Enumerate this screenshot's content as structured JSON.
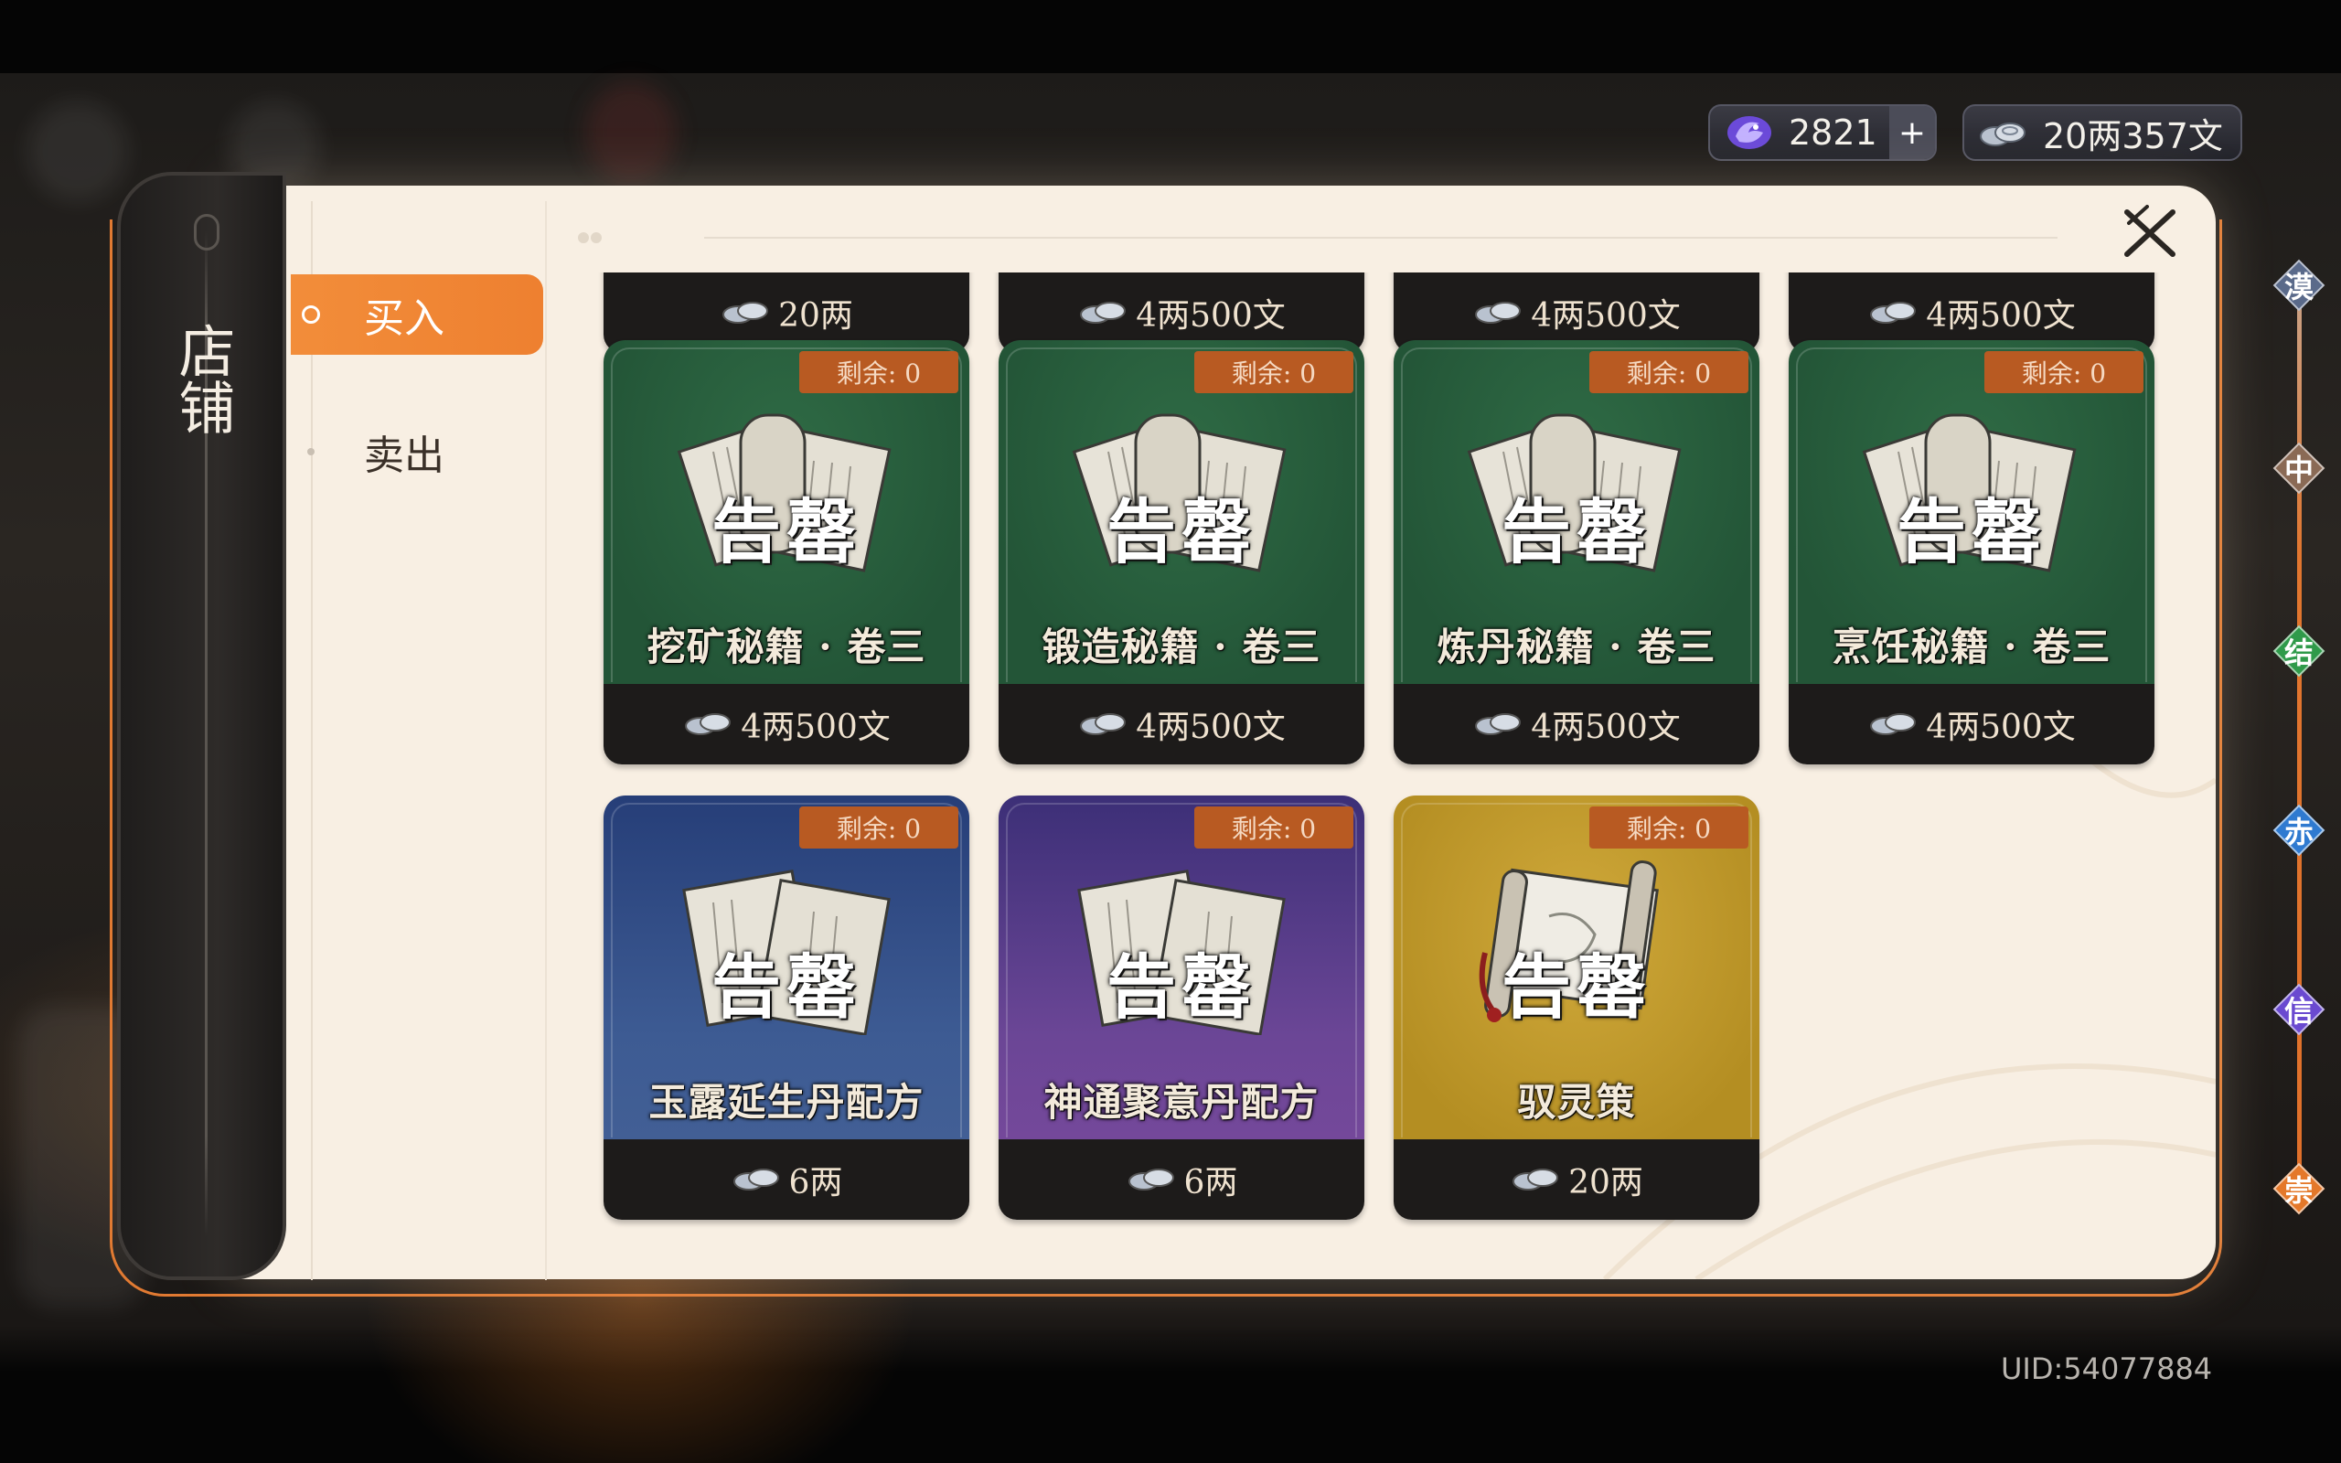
{
  "currency": {
    "spirit_stone": "2821",
    "plus": "+",
    "money": "20两357文"
  },
  "shop": {
    "title": "店铺",
    "tabs": {
      "buy": "买入",
      "sell": "卖出"
    }
  },
  "top_row_prices": [
    "20两",
    "4两500文",
    "4两500文",
    "4两500文"
  ],
  "items": [
    {
      "name": "挖矿秘籍 · 卷三",
      "remain": "剩余: 0",
      "stamp": "告罄",
      "price": "4两500文",
      "color": "green"
    },
    {
      "name": "锻造秘籍 · 卷三",
      "remain": "剩余: 0",
      "stamp": "告罄",
      "price": "4两500文",
      "color": "green"
    },
    {
      "name": "炼丹秘籍 · 卷三",
      "remain": "剩余: 0",
      "stamp": "告罄",
      "price": "4两500文",
      "color": "green"
    },
    {
      "name": "烹饪秘籍 · 卷三",
      "remain": "剩余: 0",
      "stamp": "告罄",
      "price": "4两500文",
      "color": "green"
    },
    {
      "name": "玉露延生丹配方",
      "remain": "剩余: 0",
      "stamp": "告罄",
      "price": "6两",
      "color": "blue"
    },
    {
      "name": "神通聚意丹配方",
      "remain": "剩余: 0",
      "stamp": "告罄",
      "price": "6两",
      "color": "purple"
    },
    {
      "name": "驭灵策",
      "remain": "剩余: 0",
      "stamp": "告罄",
      "price": "20两",
      "color": "gold"
    }
  ],
  "right_nav": [
    {
      "label": "漠",
      "color": "#5a6a8a"
    },
    {
      "label": "中",
      "color": "#8a6a55"
    },
    {
      "label": "结",
      "color": "#2f9a4a"
    },
    {
      "label": "赤",
      "color": "#2f7ad0"
    },
    {
      "label": "信",
      "color": "#6a4ad0"
    },
    {
      "label": "崇",
      "color": "#e4782a"
    }
  ],
  "uid": "UID:54077884",
  "icons": {
    "spirit_stone": "spirit-stone-icon",
    "money": "silver-coins-icon",
    "close": "close-icon",
    "book": "book-icon",
    "scroll": "scroll-icon"
  }
}
